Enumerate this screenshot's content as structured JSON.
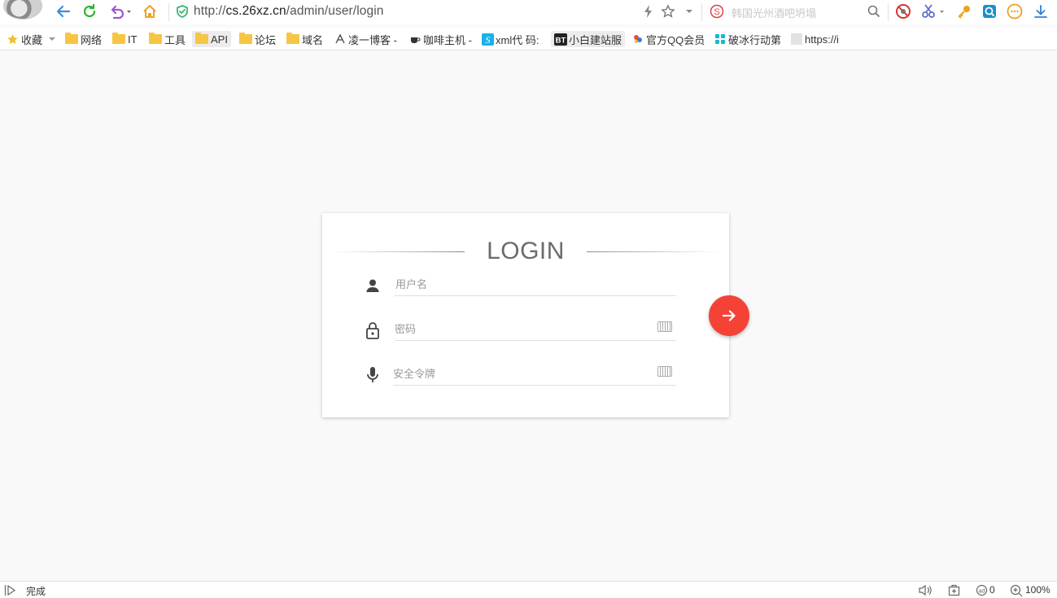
{
  "browser": {
    "url_prefix": "http://",
    "url_host": "cs.26xz.cn",
    "url_path": "/admin/user/login",
    "search_placeholder": "韩国光州酒吧坍塌",
    "zoom": "100%",
    "status_text": "完成",
    "block_count": "0"
  },
  "bookmarks": [
    {
      "label": "收藏",
      "icon": "star-icon"
    },
    {
      "label": "网络",
      "icon": "folder-icon"
    },
    {
      "label": "IT",
      "icon": "folder-icon"
    },
    {
      "label": "工具",
      "icon": "folder-icon"
    },
    {
      "label": "API",
      "icon": "folder-icon"
    },
    {
      "label": "论坛",
      "icon": "folder-icon"
    },
    {
      "label": "域名",
      "icon": "folder-icon"
    },
    {
      "label": "凌一博客 -",
      "icon": "site-icon"
    },
    {
      "label": "咖啡主机 -",
      "icon": "coffee-icon"
    },
    {
      "label": "xml代 码:",
      "icon": "site-icon"
    },
    {
      "label": "小白建站服",
      "icon": "bt-icon"
    },
    {
      "label": "官方QQ会员",
      "icon": "site-icon"
    },
    {
      "label": "破冰行动第",
      "icon": "site-icon"
    },
    {
      "label": "https://i",
      "icon": "page-icon"
    }
  ],
  "login": {
    "title": "LOGIN",
    "username_placeholder": "用户名",
    "password_placeholder": "密码",
    "token_placeholder": "安全令牌",
    "accent_color": "#f44336"
  }
}
